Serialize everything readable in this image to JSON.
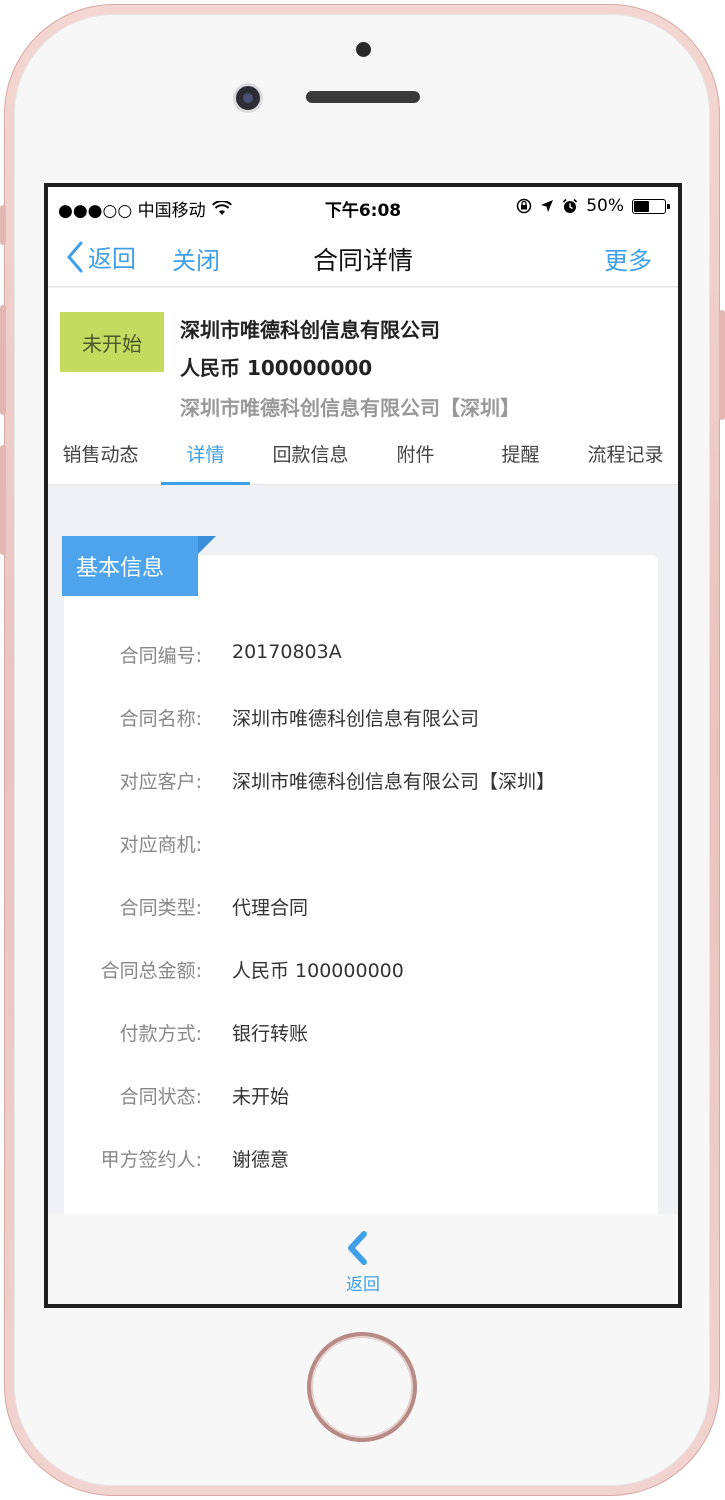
{
  "status_bar": {
    "carrier": "●●●○○ 中国移动",
    "time": "下午6:08",
    "battery": "50%",
    "battery_level": 0.5
  },
  "nav": {
    "back": "返回",
    "close": "关闭",
    "title": "合同详情",
    "more": "更多"
  },
  "summary": {
    "status": "未开始",
    "name": "深圳市唯德科创信息有限公司",
    "amount": "人民币 100000000",
    "customer": "深圳市唯德科创信息有限公司【深圳】"
  },
  "tabs": [
    {
      "label": "销售动态",
      "active": false
    },
    {
      "label": "详情",
      "active": true
    },
    {
      "label": "回款信息",
      "active": false
    },
    {
      "label": "附件",
      "active": false
    },
    {
      "label": "提醒",
      "active": false
    },
    {
      "label": "流程记录",
      "active": false
    }
  ],
  "section": {
    "title": "基本信息",
    "fields": [
      {
        "label": "合同编号:",
        "value": "20170803A"
      },
      {
        "label": "合同名称:",
        "value": "深圳市唯德科创信息有限公司"
      },
      {
        "label": "对应客户:",
        "value": "深圳市唯德科创信息有限公司【深圳】"
      },
      {
        "label": "对应商机:",
        "value": ""
      },
      {
        "label": "合同类型:",
        "value": "代理合同"
      },
      {
        "label": "合同总金额:",
        "value": "人民币 100000000"
      },
      {
        "label": "付款方式:",
        "value": "银行转账"
      },
      {
        "label": "合同状态:",
        "value": "未开始"
      },
      {
        "label": "甲方签约人:",
        "value": "谢德意"
      }
    ]
  },
  "bottom": {
    "back_label": "返回"
  },
  "colors": {
    "accent": "#3fa0e8",
    "status_chip": "#c5db5f",
    "ribbon": "#4ea3ed"
  }
}
